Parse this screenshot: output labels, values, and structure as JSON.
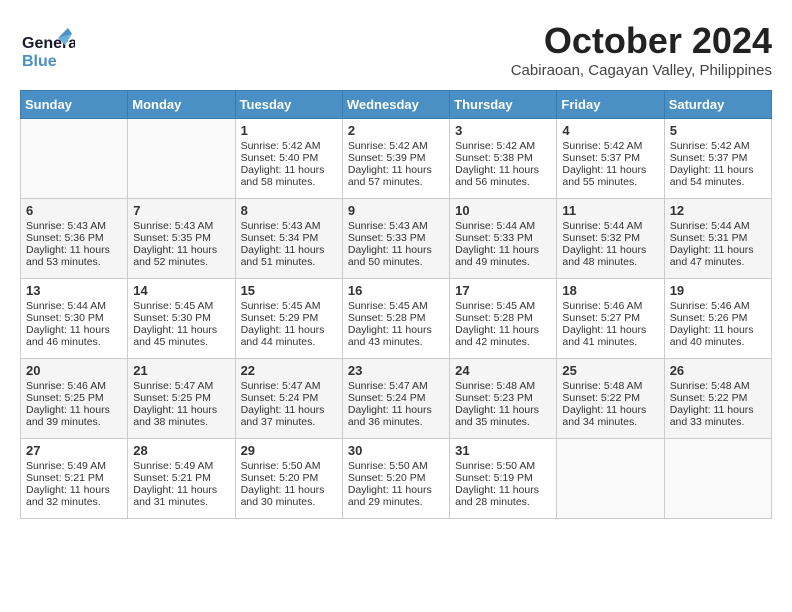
{
  "header": {
    "logo_general": "General",
    "logo_blue": "Blue",
    "month": "October 2024",
    "location": "Cabiraoan, Cagayan Valley, Philippines"
  },
  "columns": [
    "Sunday",
    "Monday",
    "Tuesday",
    "Wednesday",
    "Thursday",
    "Friday",
    "Saturday"
  ],
  "weeks": [
    [
      {
        "day": "",
        "sunrise": "",
        "sunset": "",
        "daylight": ""
      },
      {
        "day": "",
        "sunrise": "",
        "sunset": "",
        "daylight": ""
      },
      {
        "day": "1",
        "sunrise": "Sunrise: 5:42 AM",
        "sunset": "Sunset: 5:40 PM",
        "daylight": "Daylight: 11 hours and 58 minutes."
      },
      {
        "day": "2",
        "sunrise": "Sunrise: 5:42 AM",
        "sunset": "Sunset: 5:39 PM",
        "daylight": "Daylight: 11 hours and 57 minutes."
      },
      {
        "day": "3",
        "sunrise": "Sunrise: 5:42 AM",
        "sunset": "Sunset: 5:38 PM",
        "daylight": "Daylight: 11 hours and 56 minutes."
      },
      {
        "day": "4",
        "sunrise": "Sunrise: 5:42 AM",
        "sunset": "Sunset: 5:37 PM",
        "daylight": "Daylight: 11 hours and 55 minutes."
      },
      {
        "day": "5",
        "sunrise": "Sunrise: 5:42 AM",
        "sunset": "Sunset: 5:37 PM",
        "daylight": "Daylight: 11 hours and 54 minutes."
      }
    ],
    [
      {
        "day": "6",
        "sunrise": "Sunrise: 5:43 AM",
        "sunset": "Sunset: 5:36 PM",
        "daylight": "Daylight: 11 hours and 53 minutes."
      },
      {
        "day": "7",
        "sunrise": "Sunrise: 5:43 AM",
        "sunset": "Sunset: 5:35 PM",
        "daylight": "Daylight: 11 hours and 52 minutes."
      },
      {
        "day": "8",
        "sunrise": "Sunrise: 5:43 AM",
        "sunset": "Sunset: 5:34 PM",
        "daylight": "Daylight: 11 hours and 51 minutes."
      },
      {
        "day": "9",
        "sunrise": "Sunrise: 5:43 AM",
        "sunset": "Sunset: 5:33 PM",
        "daylight": "Daylight: 11 hours and 50 minutes."
      },
      {
        "day": "10",
        "sunrise": "Sunrise: 5:44 AM",
        "sunset": "Sunset: 5:33 PM",
        "daylight": "Daylight: 11 hours and 49 minutes."
      },
      {
        "day": "11",
        "sunrise": "Sunrise: 5:44 AM",
        "sunset": "Sunset: 5:32 PM",
        "daylight": "Daylight: 11 hours and 48 minutes."
      },
      {
        "day": "12",
        "sunrise": "Sunrise: 5:44 AM",
        "sunset": "Sunset: 5:31 PM",
        "daylight": "Daylight: 11 hours and 47 minutes."
      }
    ],
    [
      {
        "day": "13",
        "sunrise": "Sunrise: 5:44 AM",
        "sunset": "Sunset: 5:30 PM",
        "daylight": "Daylight: 11 hours and 46 minutes."
      },
      {
        "day": "14",
        "sunrise": "Sunrise: 5:45 AM",
        "sunset": "Sunset: 5:30 PM",
        "daylight": "Daylight: 11 hours and 45 minutes."
      },
      {
        "day": "15",
        "sunrise": "Sunrise: 5:45 AM",
        "sunset": "Sunset: 5:29 PM",
        "daylight": "Daylight: 11 hours and 44 minutes."
      },
      {
        "day": "16",
        "sunrise": "Sunrise: 5:45 AM",
        "sunset": "Sunset: 5:28 PM",
        "daylight": "Daylight: 11 hours and 43 minutes."
      },
      {
        "day": "17",
        "sunrise": "Sunrise: 5:45 AM",
        "sunset": "Sunset: 5:28 PM",
        "daylight": "Daylight: 11 hours and 42 minutes."
      },
      {
        "day": "18",
        "sunrise": "Sunrise: 5:46 AM",
        "sunset": "Sunset: 5:27 PM",
        "daylight": "Daylight: 11 hours and 41 minutes."
      },
      {
        "day": "19",
        "sunrise": "Sunrise: 5:46 AM",
        "sunset": "Sunset: 5:26 PM",
        "daylight": "Daylight: 11 hours and 40 minutes."
      }
    ],
    [
      {
        "day": "20",
        "sunrise": "Sunrise: 5:46 AM",
        "sunset": "Sunset: 5:25 PM",
        "daylight": "Daylight: 11 hours and 39 minutes."
      },
      {
        "day": "21",
        "sunrise": "Sunrise: 5:47 AM",
        "sunset": "Sunset: 5:25 PM",
        "daylight": "Daylight: 11 hours and 38 minutes."
      },
      {
        "day": "22",
        "sunrise": "Sunrise: 5:47 AM",
        "sunset": "Sunset: 5:24 PM",
        "daylight": "Daylight: 11 hours and 37 minutes."
      },
      {
        "day": "23",
        "sunrise": "Sunrise: 5:47 AM",
        "sunset": "Sunset: 5:24 PM",
        "daylight": "Daylight: 11 hours and 36 minutes."
      },
      {
        "day": "24",
        "sunrise": "Sunrise: 5:48 AM",
        "sunset": "Sunset: 5:23 PM",
        "daylight": "Daylight: 11 hours and 35 minutes."
      },
      {
        "day": "25",
        "sunrise": "Sunrise: 5:48 AM",
        "sunset": "Sunset: 5:22 PM",
        "daylight": "Daylight: 11 hours and 34 minutes."
      },
      {
        "day": "26",
        "sunrise": "Sunrise: 5:48 AM",
        "sunset": "Sunset: 5:22 PM",
        "daylight": "Daylight: 11 hours and 33 minutes."
      }
    ],
    [
      {
        "day": "27",
        "sunrise": "Sunrise: 5:49 AM",
        "sunset": "Sunset: 5:21 PM",
        "daylight": "Daylight: 11 hours and 32 minutes."
      },
      {
        "day": "28",
        "sunrise": "Sunrise: 5:49 AM",
        "sunset": "Sunset: 5:21 PM",
        "daylight": "Daylight: 11 hours and 31 minutes."
      },
      {
        "day": "29",
        "sunrise": "Sunrise: 5:50 AM",
        "sunset": "Sunset: 5:20 PM",
        "daylight": "Daylight: 11 hours and 30 minutes."
      },
      {
        "day": "30",
        "sunrise": "Sunrise: 5:50 AM",
        "sunset": "Sunset: 5:20 PM",
        "daylight": "Daylight: 11 hours and 29 minutes."
      },
      {
        "day": "31",
        "sunrise": "Sunrise: 5:50 AM",
        "sunset": "Sunset: 5:19 PM",
        "daylight": "Daylight: 11 hours and 28 minutes."
      },
      {
        "day": "",
        "sunrise": "",
        "sunset": "",
        "daylight": ""
      },
      {
        "day": "",
        "sunrise": "",
        "sunset": "",
        "daylight": ""
      }
    ]
  ]
}
